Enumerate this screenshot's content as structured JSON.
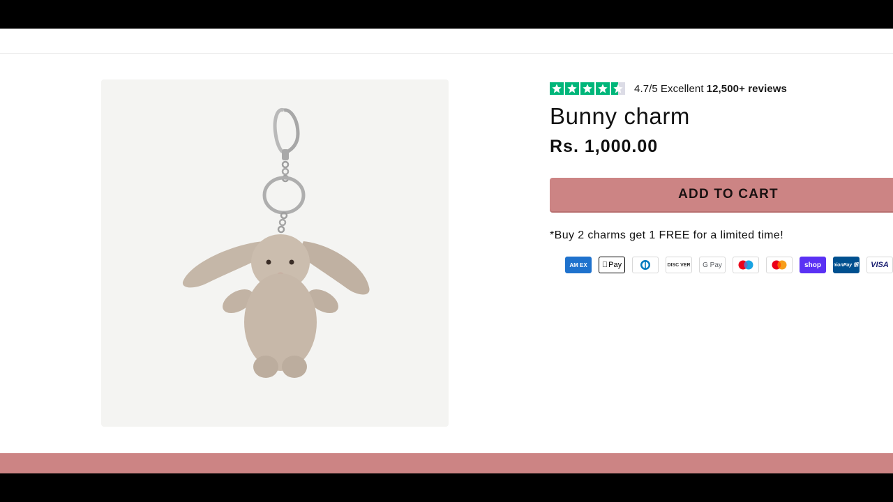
{
  "product": {
    "title": "Bunny charm",
    "price": "Rs. 1,000.00",
    "image_alt": "Beige plush bunny keychain charm",
    "add_to_cart_label": "ADD TO CART",
    "promo": "*Buy 2 charms get 1 FREE for a limited time!"
  },
  "rating": {
    "stars": 4.5,
    "score": "4.7/5",
    "label": "Excellent",
    "count": "12,500+ reviews",
    "star_color": "#00b67a"
  },
  "payments": {
    "amex": "AM EX",
    "apple_pay": "Pay",
    "discover": "DISC VER",
    "google_pay": "G Pay",
    "shop_pay": "shop",
    "union_pay": "UnionPay 银联",
    "visa": "VISA"
  },
  "colors": {
    "accent": "#cc8484",
    "shop_pay": "#5a31f4",
    "union_pay": "#00508f",
    "amex": "#1f72cd"
  }
}
